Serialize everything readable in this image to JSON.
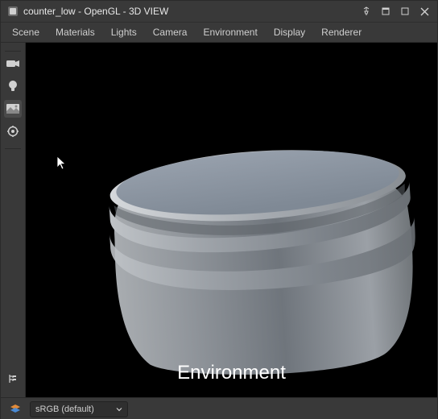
{
  "window": {
    "title": "counter_low - OpenGL - 3D VIEW"
  },
  "menubar": {
    "items": [
      {
        "label": "Scene"
      },
      {
        "label": "Materials"
      },
      {
        "label": "Lights"
      },
      {
        "label": "Camera"
      },
      {
        "label": "Environment"
      },
      {
        "label": "Display"
      },
      {
        "label": "Renderer"
      }
    ]
  },
  "sidebar": {
    "icons": [
      {
        "name": "camera-icon"
      },
      {
        "name": "lightbulb-icon"
      },
      {
        "name": "environment-icon"
      },
      {
        "name": "settings-icon"
      }
    ],
    "bottom_icon": {
      "name": "tree-icon"
    }
  },
  "viewport": {
    "overlay_label": "Environment",
    "object_name": "counter_low"
  },
  "statusbar": {
    "colorspace": {
      "selected": "sRGB (default)"
    }
  }
}
